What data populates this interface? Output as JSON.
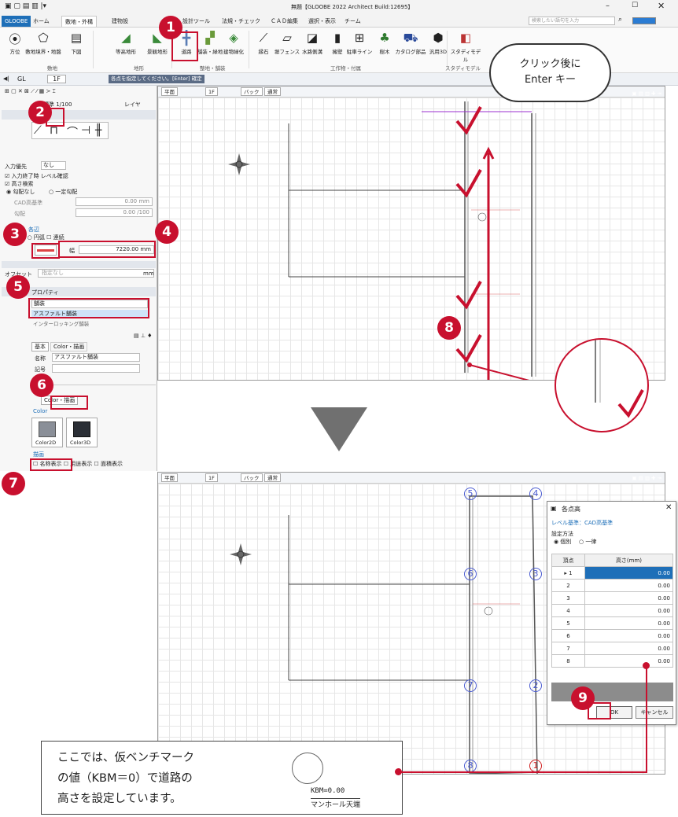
{
  "titlebar": {
    "title": "無題【GLOOBE 2022 Architect Build:12695】"
  },
  "tabs": [
    "GLOOBE",
    "ホーム",
    "敷地・外構",
    "建物設",
    "設計ツール",
    "法規・チェック",
    "ＣＡＤ編集",
    "選択・表示",
    "チーム"
  ],
  "search": {
    "placeholder": "検索したい語句を入力"
  },
  "ribbon": {
    "buttons": [
      "方位",
      "敷地境界・地盤",
      "下図",
      "等高地形",
      "景観地形",
      "道路",
      "舗装・緑地",
      "建物緑化",
      "縁石",
      "塀フェンス",
      "水路側溝",
      "擁壁",
      "駐車ライン",
      "樹木",
      "カタログ部品",
      "汎用3D",
      "スタディモデル"
    ],
    "groups": [
      "敷地",
      "地形",
      "整地・舗装",
      "工作物・付属",
      "スタディモデル"
    ]
  },
  "toolrow": {
    "floor": "1F",
    "gl": "GL",
    "prompt": "各点を指定してください。",
    "enter": "[Enter] 確定"
  },
  "panel": {
    "scale": "標準 1/100",
    "layer": "レイヤ",
    "road_header": "道路",
    "input_priority_label": "入力優先",
    "input_priority_value": "なし",
    "check1": "入力終了時 レベル確認",
    "check2": "高さ検索",
    "radio1": "勾配なし",
    "radio2": "一定勾配",
    "cad_label": "CAD高基準",
    "cad_value": "0.00 mm",
    "slope_label": "勾配",
    "slope_value": "0.00 /100",
    "side_header": "各辺",
    "side_opt1": "線分",
    "side_opt2": "円弧",
    "side_opt3": "連続",
    "width_label": "幅",
    "width_value": "7220.00 mm",
    "offset_label": "オフセット",
    "offset_value": "指定なし",
    "offset_unit": "mm",
    "prop_header": "プロパティ",
    "dropdown_value": "舗装",
    "dropdown_selected": "アスファルト舗装",
    "dropdown_next": "インターロッキング舗装",
    "tab_basic": "基本",
    "tab_color": "Color・描画",
    "name_label": "名称",
    "name_value": "アスファルト舗装",
    "remarks_label": "記号",
    "tab_color2": "Color・描画",
    "color_header": "Color",
    "color2d": "Color2D",
    "color3d": "Color3D",
    "draw_header": "描画",
    "draw_opt1": "名称表示",
    "draw_opt2": "用途表示",
    "draw_opt3": "面積表示"
  },
  "canvas": {
    "plan": "平面",
    "floor": "1F",
    "back": "バック",
    "mode": "通常"
  },
  "speech": {
    "line1": "クリック後に",
    "line2": "Enter キー"
  },
  "badges": [
    "1",
    "2",
    "3",
    "4",
    "5",
    "6",
    "7",
    "8",
    "9"
  ],
  "vertices": [
    "5",
    "4",
    "6",
    "3",
    "7",
    "2",
    "8",
    "1"
  ],
  "dialog": {
    "title": "各点高",
    "level": "レベル基準：CAD高基準",
    "method_label": "設定方法",
    "opt_individual": "個別",
    "opt_uniform": "一律",
    "col_vertex": "頂点",
    "col_height": "高さ(mm)",
    "rows": [
      {
        "v": "1",
        "h": "0.00"
      },
      {
        "v": "2",
        "h": "0.00"
      },
      {
        "v": "3",
        "h": "0.00"
      },
      {
        "v": "4",
        "h": "0.00"
      },
      {
        "v": "5",
        "h": "0.00"
      },
      {
        "v": "6",
        "h": "0.00"
      },
      {
        "v": "7",
        "h": "0.00"
      },
      {
        "v": "8",
        "h": "0.00"
      }
    ],
    "ok": "OK",
    "cancel": "キャンセル"
  },
  "callout": {
    "line1": "ここでは、仮ベンチマーク",
    "line2": "の値（KBM＝0）で道路の",
    "line3": "高さを設定しています。",
    "kbm": "KBM=0.00",
    "manhole": "マンホール天端"
  },
  "colors": {
    "accent": "#c8102e",
    "brand": "#1e6fb8",
    "vertex_blue": "#4a5bd1",
    "vertex_red": "#d02020"
  }
}
